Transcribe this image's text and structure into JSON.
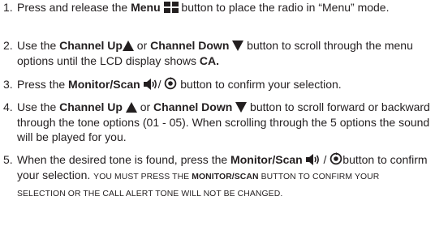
{
  "steps": [
    {
      "number": "1.",
      "t1": "Press and release the ",
      "b1": "Menu",
      "t2": " button to place the radio in “Menu” mode.",
      "icon": "menu-grid-icon"
    },
    {
      "number": "2.",
      "t1": "Use the ",
      "b1": "Channel Up",
      "t2": " or ",
      "b2": "Channel Down",
      "t3": " button to scroll through the menu options until the LCD display shows ",
      "b3": "CA.",
      "icons": [
        "triangle-up-icon",
        "triangle-down-icon"
      ]
    },
    {
      "number": "3.",
      "t1": "Press the ",
      "b1": "Monitor/Scan",
      "t2": "/ ",
      "t3": " button to confirm your selection.",
      "icons": [
        "speaker-icon",
        "scan-icon"
      ]
    },
    {
      "number": "4.",
      "t1": "Use the ",
      "b1": "Channel Up",
      "t2": " or ",
      "b2": "Channel Down",
      "t3": " button to scroll forward or backward through the tone options (01 - 05).  When scrolling through the 5 options the sound will be played for you.",
      "icons": [
        "triangle-up-icon",
        "triangle-down-icon"
      ]
    },
    {
      "number": "5.",
      "t1": "When the desired tone is found, press the ",
      "b1": "Monitor/Scan",
      "t2": " / ",
      "t3": "button to confirm your selection. ",
      "s1": "YOU MUST PRESS THE ",
      "sb1": "MONITOR/SCAN",
      "s2": " BUTTON TO CONFIRM YOUR SELECTION OR THE CALL ALERT TONE WILL NOT BE CHANGED.",
      "icons": [
        "speaker-icon",
        "scan-icon"
      ]
    }
  ],
  "colors": {
    "text": "#231f20",
    "icon": "#231f20",
    "background": "#ffffff"
  }
}
